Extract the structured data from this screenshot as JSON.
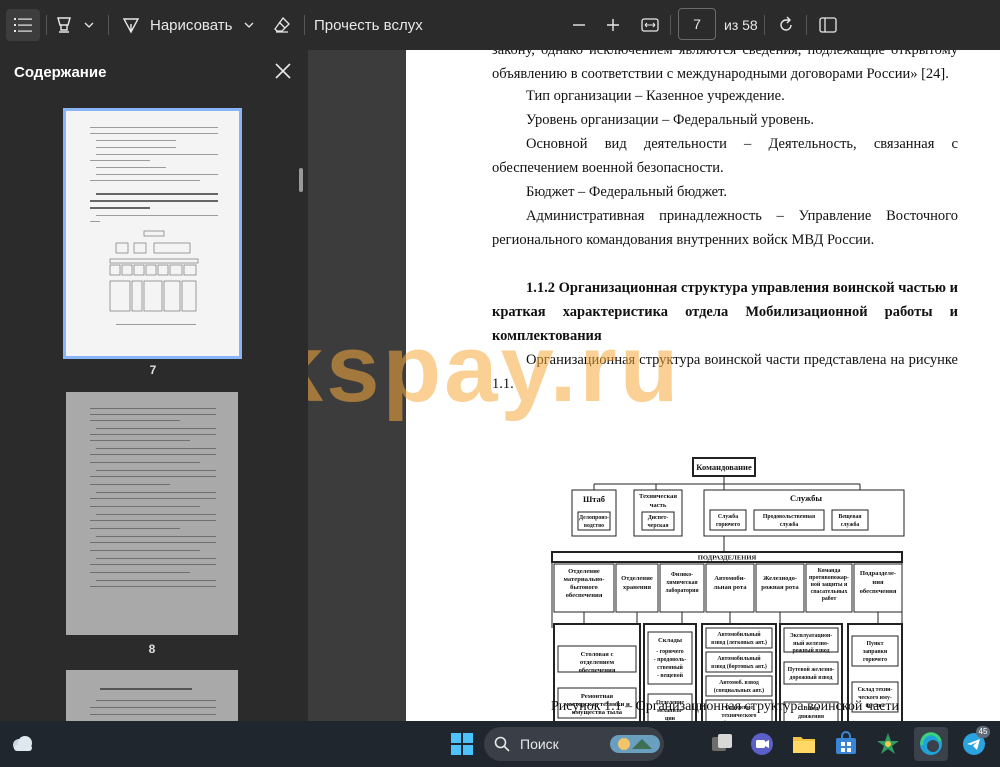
{
  "toolbar": {
    "draw_label": "Нарисовать",
    "read_aloud_label": "Прочесть вслух",
    "current_page": "7",
    "total_pages_label": "из 58"
  },
  "sidebar": {
    "title": "Содержание",
    "thumbnails": [
      {
        "page_label": "7"
      },
      {
        "page_label": "8"
      }
    ]
  },
  "document": {
    "paragraphs": [
      "закону, однако исключением являются сведения, подлежащие открытому объявлению в соответствии с международными договорами России» [24].",
      "Тип организации – Казенное учреждение.",
      "Уровень организации – Федеральный уровень.",
      "Основной вид деятельности – Деятельность, связанная с обеспечением военной безопасности.",
      "Бюджет – Федеральный бюджет.",
      "Административная принадлежность – Управление Восточного регионального командования внутренних войск МВД России."
    ],
    "section_heading": "1.1.2 Организационная структура управления воинской частью и краткая характеристика отдела Мобилизационной работы и комплектования",
    "intro_paragraph": "Организационная структура воинской части представлена на рисунке 1.1.",
    "figure_caption": "Рисунок 1.1 – Организационная структура воинской части"
  },
  "org_chart": {
    "root": "Командование",
    "top_units": {
      "staff": {
        "title": "Штаб",
        "sub": "Делопроиз-водство"
      },
      "tech": {
        "title": "Техническая часть",
        "sub": "Диспет-черская"
      },
      "services": {
        "title": "Службы",
        "subs": [
          "Служба горючего",
          "Продовольственная служба",
          "Вещевая служба"
        ]
      }
    },
    "divisions_title": "ПОДРАЗДЕЛЕНИЯ",
    "divisions": [
      "Отделение материально-бытового обеспечения",
      "Отделение хранения",
      "Физико-химическая лаборатория",
      "Автомобильная рота",
      "Железнодорожная рота",
      "Команда противопожарной защиты и спасательных работ",
      "Подразделение обеспечения"
    ],
    "sub_units": {
      "col1": [
        "Столовая с отделением обеспечения",
        "Ремонтная мастерская техники и имущества тыла"
      ],
      "col2": [
        "Склады",
        "- горючего",
        "- продовольственного",
        "- вещевой",
        "Отделение механизации"
      ],
      "col3": [
        "Автомобильный взвод (легковых авт.)",
        "Автомобильный взвод (бортовых авт.)",
        "Автомоб. взвод (специальных авт.)",
        "Отделение технического обслуживания"
      ],
      "col4": [
        "Эксплуатационный железнодорожный взвод",
        "Путевой железнодорожный взвод",
        "Взвод движения"
      ],
      "col5": [
        "Пункт заправки горючего",
        "Склад технического имущества"
      ]
    }
  },
  "watermark": "workspay.ru",
  "taskbar": {
    "search_label": "Поиск",
    "telegram_badge": "45"
  },
  "colors": {
    "toolbar_bg": "#2b2b2b",
    "selected_thumb_border": "#8ab4f8",
    "watermark": "#f5aa3c",
    "taskbar_bg": "#20262e"
  }
}
